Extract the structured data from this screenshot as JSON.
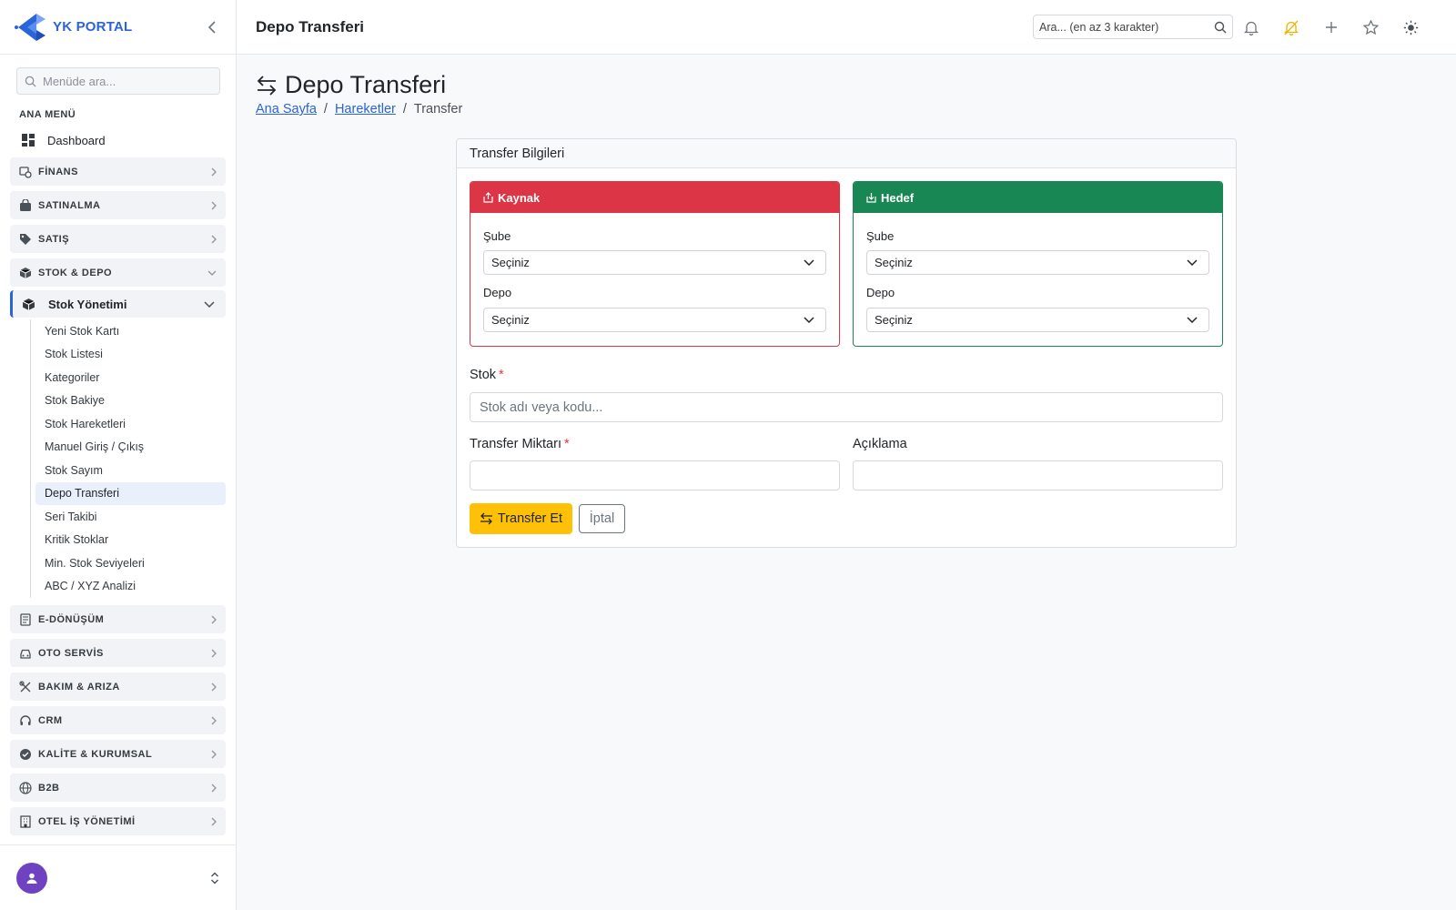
{
  "brand": {
    "name": "YK PORTAL"
  },
  "sidebar": {
    "search_placeholder": "Menüde ara...",
    "section_label": "ANA MENÜ",
    "dashboard_label": "Dashboard",
    "groups": [
      {
        "label": "FİNANS",
        "icon": "finance-icon"
      },
      {
        "label": "SATINALMA",
        "icon": "bag-icon"
      },
      {
        "label": "SATIŞ",
        "icon": "tag-icon"
      },
      {
        "label": "STOK & DEPO",
        "icon": "box-icon",
        "expanded": true
      },
      {
        "label": "E-DÖNÜŞÜM",
        "icon": "document-icon"
      },
      {
        "label": "OTO SERVİS",
        "icon": "car-icon"
      },
      {
        "label": "BAKIM & ARIZA",
        "icon": "tools-icon"
      },
      {
        "label": "CRM",
        "icon": "headset-icon"
      },
      {
        "label": "KALİTE & KURUMSAL",
        "icon": "badge-check-icon"
      },
      {
        "label": "B2B",
        "icon": "globe-icon"
      },
      {
        "label": "OTEL İŞ YÖNETİMİ",
        "icon": "building-icon"
      }
    ],
    "submenu_parent": "Stok Yönetimi",
    "submenu_items": [
      "Yeni Stok Kartı",
      "Stok Listesi",
      "Kategoriler",
      "Stok Bakiye",
      "Stok Hareketleri",
      "Manuel Giriş / Çıkış",
      "Stok Sayım",
      "Depo Transferi",
      "Seri Takibi",
      "Kritik Stoklar",
      "Min. Stok Seviyeleri",
      "ABC / XYZ Analizi"
    ],
    "active_submenu_item": "Depo Transferi"
  },
  "topbar": {
    "title": "Depo Transferi",
    "search_placeholder": "Ara... (en az 3 karakter)"
  },
  "page": {
    "title": "Depo Transferi",
    "breadcrumb": {
      "home": "Ana Sayfa",
      "section": "Hareketler",
      "current": "Transfer",
      "separator": "/"
    }
  },
  "form": {
    "card_title": "Transfer Bilgileri",
    "source": {
      "title": "Kaynak",
      "branch_label": "Şube",
      "branch_value": "Seçiniz",
      "depot_label": "Depo",
      "depot_value": "Seçiniz"
    },
    "target": {
      "title": "Hedef",
      "branch_label": "Şube",
      "branch_value": "Seçiniz",
      "depot_label": "Depo",
      "depot_value": "Seçiniz"
    },
    "stock_label": "Stok",
    "stock_placeholder": "Stok adı veya kodu...",
    "quantity_label": "Transfer Miktarı",
    "quantity_value": "",
    "description_label": "Açıklama",
    "description_value": "",
    "required_mark": "*",
    "submit_label": "Transfer Et",
    "cancel_label": "İptal"
  },
  "colors": {
    "brand": "#2b63d9",
    "source": "#dc3545",
    "target": "#198754",
    "primary_button": "#ffc107",
    "notification_accent": "#f0b400"
  }
}
